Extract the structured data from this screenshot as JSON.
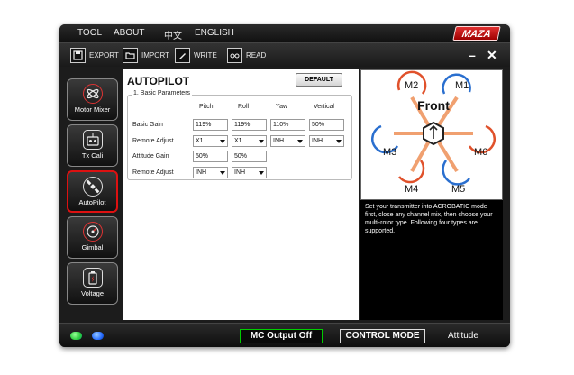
{
  "menu": {
    "tool": "TOOL",
    "about": "ABOUT",
    "chinese": "中文",
    "english": "ENGLISH",
    "logo": "MAZA"
  },
  "toolbar": {
    "export": "EXPORT",
    "import": "IMPORT",
    "write": "WRITE",
    "read": "READ",
    "minimize": "–",
    "close": "✕"
  },
  "sidebar": {
    "motor_mixer": "Motor Mixer",
    "tx_cali": "Tx Cali",
    "autopilot": "AutoPilot",
    "gimbal": "Gimbal",
    "voltage": "Voltage"
  },
  "page": {
    "title": "AUTOPILOT",
    "default_btn": "DEFAULT",
    "group_title": "1. Basic Parameters",
    "columns": [
      "Pitch",
      "Roll",
      "Yaw",
      "Vertical"
    ],
    "rows": {
      "basic_gain": {
        "label": "Basic Gain",
        "values": [
          "119%",
          "119%",
          "110%",
          "50%"
        ]
      },
      "remote_adjust_1": {
        "label": "Remote Adjust",
        "values": [
          "X1",
          "X1",
          "INH",
          "INH"
        ]
      },
      "attitude_gain": {
        "label": "Attitude Gain",
        "values": [
          "50%",
          "50%"
        ]
      },
      "remote_adjust_2": {
        "label": "Remote Adjust",
        "values": [
          "INH",
          "INH"
        ]
      }
    }
  },
  "diagram": {
    "front": "Front",
    "motors": [
      "M1",
      "M2",
      "M3",
      "M4",
      "M5",
      "M6"
    ]
  },
  "info_text": "Set your transmitter into ACROBATIC mode first, close any channel mix, then choose your multi-rotor type. Following four types are supported.",
  "status": {
    "mc_output": "MC Output Off",
    "control_mode": "CONTROL MODE",
    "attitude": "Attitude"
  },
  "colors": {
    "accent_red": "#d11111",
    "led_green": "#2ecc40",
    "led_blue": "#2a6fff",
    "arm_red": "#e0512b",
    "arm_blue": "#2a6fcf"
  }
}
